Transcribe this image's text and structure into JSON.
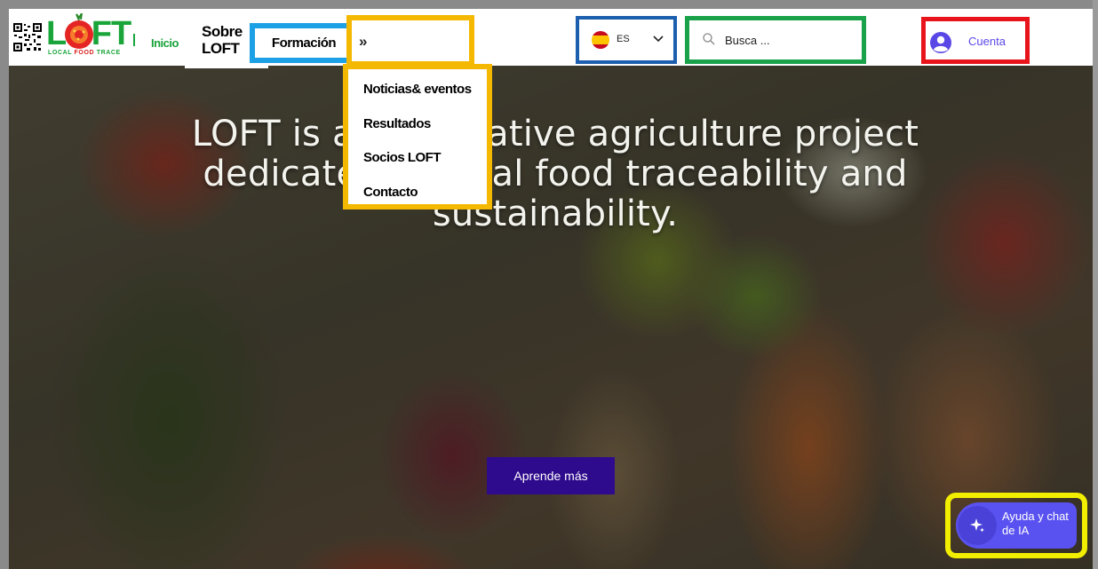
{
  "logo": {
    "wordmark": "LOFT",
    "tagline_local": "LOCAL",
    "tagline_food": "FOOD",
    "tagline_trace": "TRACE"
  },
  "nav": {
    "inicio": "Inicio",
    "sobre": "Sobre LOFT",
    "formacion": "Formación",
    "more": "»"
  },
  "dropdown": {
    "items": [
      {
        "label": "Noticias& eventos"
      },
      {
        "label": "Resultados"
      },
      {
        "label": "Socios LOFT"
      },
      {
        "label": "Contacto"
      }
    ]
  },
  "language": {
    "code": "ES",
    "flag_icon": "spain-flag-icon"
  },
  "search": {
    "placeholder": "Busca ..."
  },
  "account": {
    "label": "Cuenta"
  },
  "hero": {
    "title": "LOFT is an innovative agriculture project dedicated to local food traceability and sustainability.",
    "cta_label": "Aprende más"
  },
  "ai_chat": {
    "label": "Ayuda y chat de IA"
  },
  "colors": {
    "brand_green": "#1aa53a",
    "formacion_border": "#1ea0e6",
    "dropdown_border": "#f5b800",
    "language_border": "#1c5fae",
    "search_border": "#1aa24a",
    "account_border": "#e8141c",
    "ai_border": "#f2ee00",
    "cta_bg": "#2e0a8c",
    "ai_bg": "#5a52f0"
  }
}
